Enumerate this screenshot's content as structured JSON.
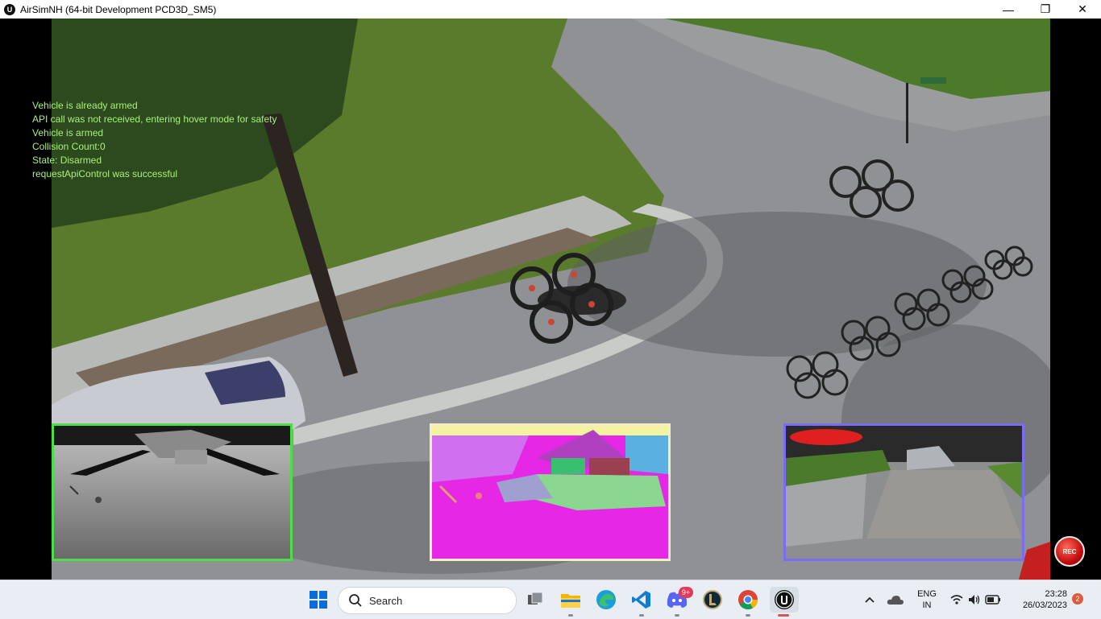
{
  "window": {
    "app_icon_text": "U",
    "title": "AirSimNH (64-bit Development PCD3D_SM5)",
    "minimize": "—",
    "maximize": "❐",
    "close": "✕"
  },
  "debug_messages": [
    "Vehicle is already armed",
    "API call was not received, entering hover mode for safety",
    "Vehicle is armed",
    "Collision Count:0",
    "State: Disarmed",
    "requestApiControl was successful"
  ],
  "colors": {
    "debug_text": "#a8f07a",
    "depth_border": "#4cde45",
    "seg_border": "#f4eec6",
    "scene_border": "#7b6cf4",
    "rec": "#d01414",
    "taskbar": "#e9eef5"
  },
  "rec_label": "REC",
  "taskbar": {
    "search_label": "Search",
    "icons": [
      "windows-start-icon",
      "search-icon",
      "task-view-icon",
      "file-explorer-icon",
      "edge-icon",
      "vscode-icon",
      "discord-icon",
      "league-icon",
      "chrome-icon",
      "unreal-engine-icon"
    ],
    "discord_badge": "9+",
    "tray": {
      "lang_line1": "ENG",
      "lang_line2": "IN",
      "time": "23:28",
      "date": "26/03/2023",
      "notification_count": "2"
    }
  }
}
